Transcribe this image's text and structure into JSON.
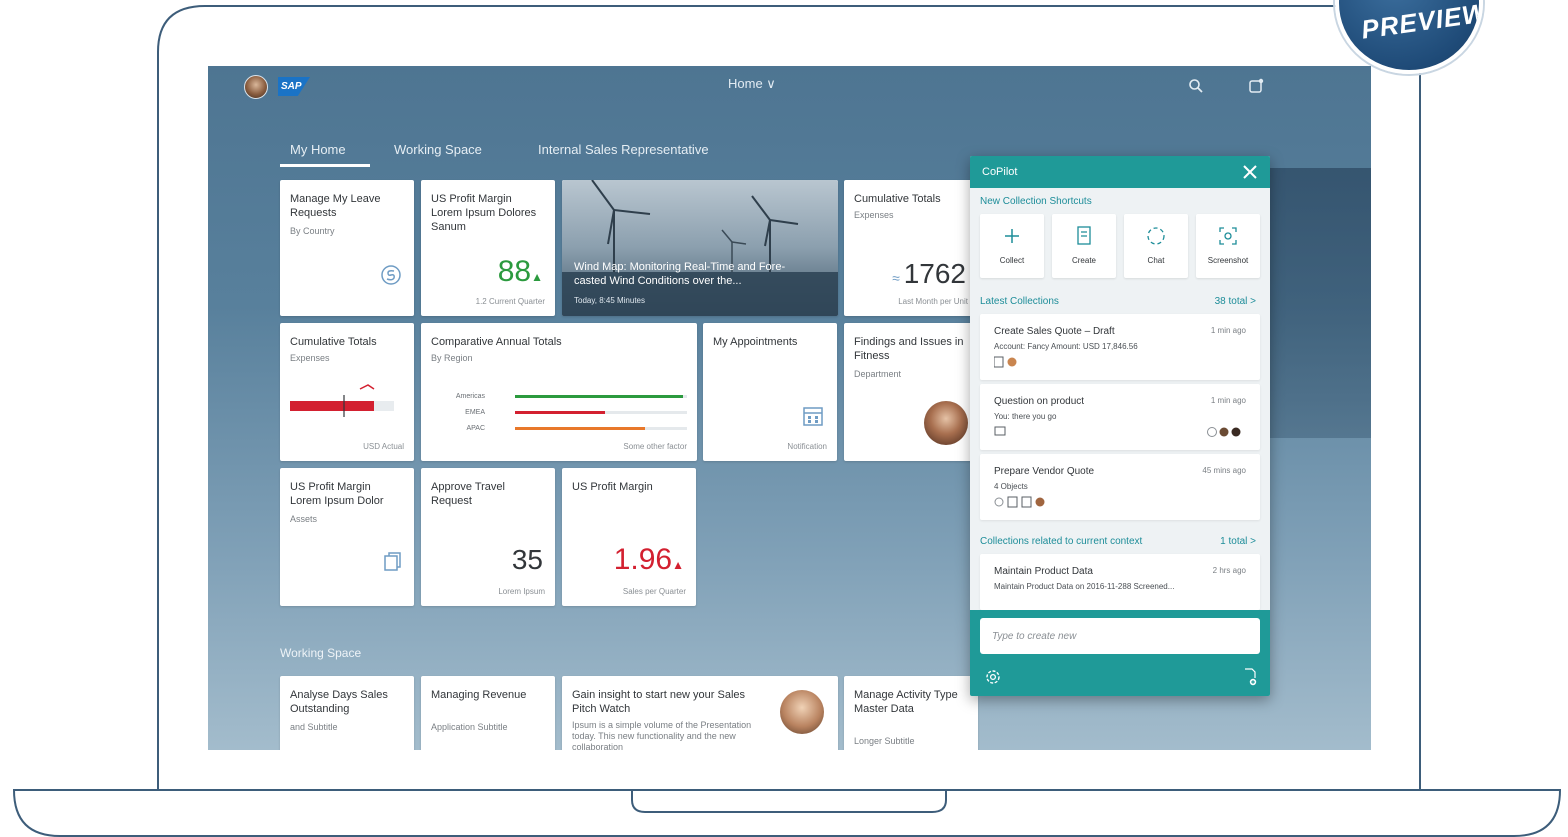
{
  "badge": {
    "text": "PREVIEW"
  },
  "shell": {
    "logo": "SAP",
    "title": "Home ∨"
  },
  "tabs": [
    "My Home",
    "Working Space",
    "Internal Sales Representative"
  ],
  "tiles": {
    "leave": {
      "title": "Manage My Leave Requests",
      "sub": "By Country"
    },
    "margin1": {
      "title": "US Profit Margin Lorem Ipsum Dolores Sanum",
      "value": "88",
      "foot": "1.2 Current Quarter"
    },
    "wind": {
      "title": "Wind Map: Monitoring Real-Time and Fore-casted Wind Conditions over the...",
      "foot": "Today, 8:45 Minutes"
    },
    "cumulative1": {
      "title": "Cumulative Totals",
      "sub": "Expenses",
      "value": "1762",
      "foot": "Last Month per Unit"
    },
    "cumulative2": {
      "title": "Cumulative Totals",
      "sub": "Expenses",
      "foot": "USD Actual"
    },
    "comparative": {
      "title": "Comparative Annual Totals",
      "sub": "By Region",
      "rows": [
        "Americas",
        "EMEA",
        "APAC"
      ],
      "foot": "Some other factor"
    },
    "appointments": {
      "title": "My Appointments",
      "foot": "Notification"
    },
    "findings": {
      "title": "Findings and Issues in Fitness",
      "sub": "Department"
    },
    "margin2": {
      "title": "US Profit Margin Lorem Ipsum Dolor",
      "sub": "Assets"
    },
    "approve": {
      "title": "Approve Travel Request",
      "value": "35",
      "foot": "Lorem Ipsum"
    },
    "margin3": {
      "title": "US Profit Margin",
      "value": "1.96",
      "foot": "Sales per Quarter"
    },
    "working_label": "Working Space",
    "bottom": [
      {
        "title": "Analyse Days Sales Outstanding",
        "sub": "and Subtitle"
      },
      {
        "title": "Managing Revenue",
        "sub": "Application Subtitle"
      },
      {
        "title": "Gain insight to start new your Sales Pitch Watch",
        "sub": "Ipsum is a simple volume of the Presentation today. This new functionality and the new collaboration"
      },
      {
        "title": "Manage Activity Type Master Data",
        "sub": "Longer Subtitle"
      }
    ]
  },
  "copilot": {
    "title": "CoPilot",
    "shortcuts_label": "New Collection Shortcuts",
    "shortcuts": [
      "Collect",
      "Create",
      "Chat",
      "Screenshot"
    ],
    "latest_label": "Latest Collections",
    "latest_more": "38 total >",
    "cards": [
      {
        "title": "Create Sales Quote – Draft",
        "time": "1 min ago",
        "sub": "Account: Fancy Amount: USD 17,846.56"
      },
      {
        "title": "Question on product",
        "time": "1 min ago",
        "sub": "You: there you go"
      },
      {
        "title": "Prepare Vendor Quote",
        "time": "45 mins ago",
        "sub": "4 Objects"
      }
    ],
    "context_label": "Collections related to current context",
    "context_more": "1 total >",
    "context_card": {
      "title": "Maintain Product Data",
      "time": "2 hrs ago",
      "sub": "Maintain Product Data on 2016-11-288 Screened..."
    },
    "input_placeholder": "Type to create new"
  },
  "colors": {
    "teal": "#1f9a98",
    "kpi_green": "#2b9a3e",
    "kpi_red": "#d32030"
  }
}
